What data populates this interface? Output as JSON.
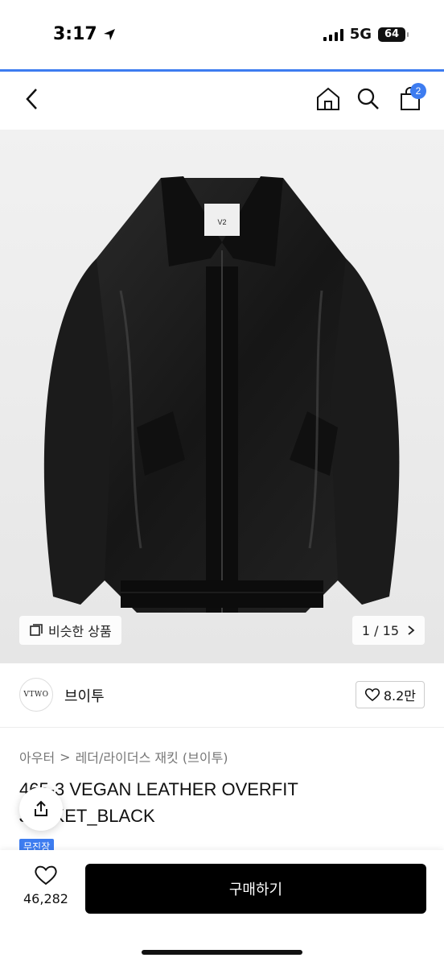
{
  "status_bar": {
    "time": "3:17",
    "network": "5G",
    "battery": "64"
  },
  "nav": {
    "cart_count": "2"
  },
  "image": {
    "collar_label": "V2",
    "similar_label": "비슷한 상품",
    "page_current": "1",
    "page_total": "15",
    "page_separator": "/",
    "page_progress": 0.0667
  },
  "brand": {
    "logo_text": "VTWO",
    "name": "브이투",
    "likes": "8.2만"
  },
  "breadcrumb": {
    "level1": "아우터",
    "separator": ">",
    "level2": "레더/라이더스 재킷 (브이투)"
  },
  "product": {
    "title": "465-3 VEGAN LEATHER OVERFIT JACKET_BLACK",
    "tag": "무진장"
  },
  "bottom": {
    "wish_count": "46,282",
    "buy_label": "구매하기"
  },
  "colors": {
    "accent": "#3d7cf0",
    "buy_bg": "#000000"
  },
  "icons": [
    "back-icon",
    "home-icon",
    "search-icon",
    "cart-icon",
    "similar-icon",
    "chevron-right-icon",
    "heart-icon",
    "share-icon",
    "location-arrow-icon"
  ]
}
